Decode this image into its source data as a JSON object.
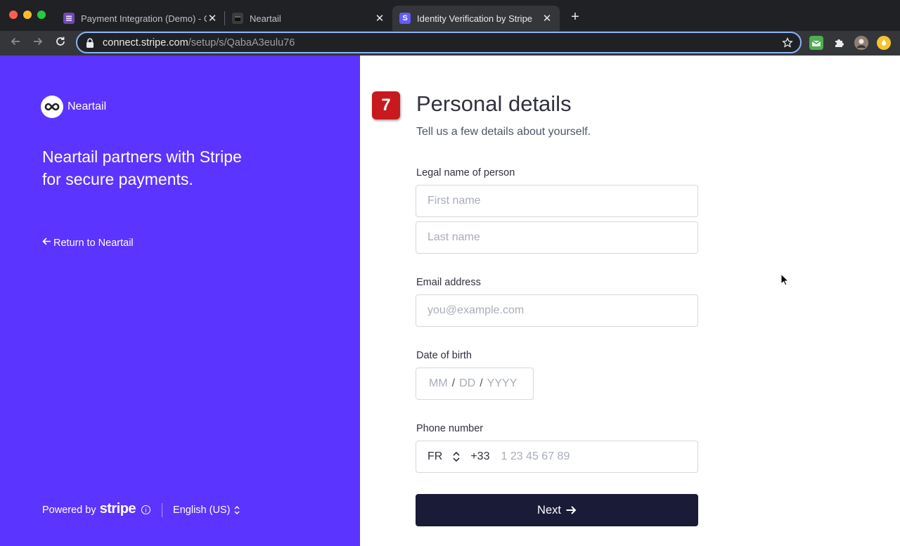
{
  "browser": {
    "tabs": [
      {
        "title": "Payment Integration (Demo) - Google Sheets",
        "favicon_color": "#7248b9"
      },
      {
        "title": "Neartail",
        "favicon_color": "#3c3c3c"
      },
      {
        "title": "Identity Verification by Stripe",
        "favicon_color": "#635bff",
        "favicon_letter": "S",
        "active": true
      }
    ],
    "url": {
      "host": "connect.stripe.com",
      "path": "/setup/s/QabaA3eulu76"
    }
  },
  "left": {
    "brand_name": "Neartail",
    "headline": "Neartail partners with Stripe for secure payments.",
    "return_link": "Return to Neartail",
    "footer": {
      "powered_by": "Powered by",
      "stripe": "stripe",
      "language": "English (US)"
    }
  },
  "form": {
    "step": "7",
    "title": "Personal details",
    "subtitle": "Tell us a few details about yourself.",
    "legal_name_label": "Legal name of person",
    "first_name_placeholder": "First name",
    "last_name_placeholder": "Last name",
    "email_label": "Email address",
    "email_placeholder": "you@example.com",
    "dob_label": "Date of birth",
    "dob": {
      "mm": "MM",
      "dd": "DD",
      "yyyy": "YYYY"
    },
    "phone_label": "Phone number",
    "phone": {
      "country": "FR",
      "dial_code": "+33",
      "placeholder": "1 23 45 67 89"
    },
    "next_label": "Next"
  },
  "colors": {
    "brand_purple": "#5b34ff",
    "button_dark": "#1a1b36",
    "step_badge": "#c8191e"
  }
}
